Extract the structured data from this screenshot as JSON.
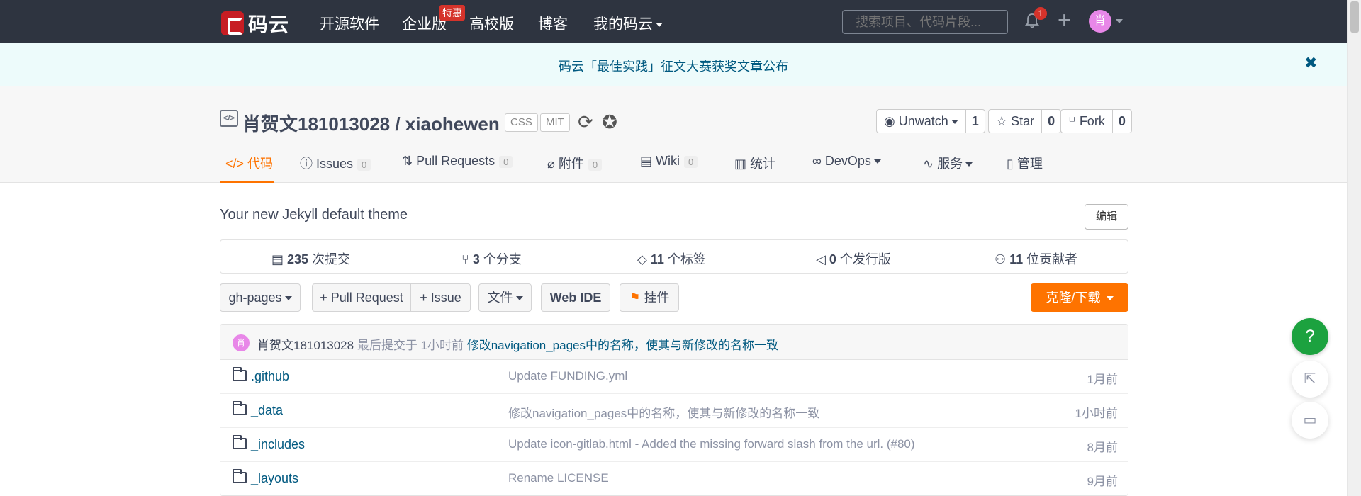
{
  "topnav": {
    "logo_text": "码云",
    "items": [
      "开源软件",
      "企业版",
      "高校版",
      "博客",
      "我的码云"
    ],
    "hot_badge": "特惠",
    "search_placeholder": "搜索项目、代码片段...",
    "notification_count": "1",
    "avatar_letter": "肖"
  },
  "notice": {
    "text": "码云「最佳实践」征文大赛获奖文章公布",
    "close": "✖"
  },
  "repo": {
    "title": "肖贺文181013028 / xiaohewen",
    "tags": [
      "CSS",
      "MIT"
    ],
    "watch_label": "Unwatch",
    "watch_count": "1",
    "star_label": "Star",
    "star_count": "0",
    "fork_label": "Fork",
    "fork_count": "0"
  },
  "tabs": [
    {
      "label": "代码",
      "icon": "code-icon"
    },
    {
      "label": "Issues",
      "count": "0"
    },
    {
      "label": "Pull Requests",
      "count": "0"
    },
    {
      "label": "附件",
      "count": "0"
    },
    {
      "label": "Wiki",
      "count": "0"
    },
    {
      "label": "统计"
    },
    {
      "label": "DevOps"
    },
    {
      "label": "服务"
    },
    {
      "label": "管理"
    }
  ],
  "description": "Your new Jekyll default theme",
  "edit_label": "编辑",
  "stats": [
    {
      "num": "235",
      "label": " 次提交"
    },
    {
      "num": "3",
      "label": " 个分支"
    },
    {
      "num": "11",
      "label": " 个标签"
    },
    {
      "num": "0",
      "label": " 个发行版"
    },
    {
      "num": "11",
      "label": " 位贡献者"
    }
  ],
  "toolbar": {
    "branch": "gh-pages",
    "pull_request": "+ Pull Request",
    "issue": "+ Issue",
    "file": "文件",
    "web_ide": "Web IDE",
    "widget": "挂件",
    "clone": "克隆/下载"
  },
  "last_commit": {
    "avatar": "肖",
    "author": "肖贺文181013028",
    "time": " 最后提交于 1小时前 ",
    "message": "修改navigation_pages中的名称，使其与新修改的名称一致"
  },
  "files": [
    {
      "name": ".github",
      "message": "Update FUNDING.yml",
      "time": "1月前"
    },
    {
      "name": "_data",
      "message": "修改navigation_pages中的名称，使其与新修改的名称一致",
      "time": "1小时前"
    },
    {
      "name": "_includes",
      "message": "Update icon-gitlab.html - Added the missing forward slash from the url. (#80)",
      "time": "8月前"
    },
    {
      "name": "_layouts",
      "message": "Rename LICENSE",
      "time": "9月前"
    }
  ],
  "float": {
    "help": "?"
  },
  "colors": {
    "accent": "#fe7300",
    "nav_bg": "#2e3440",
    "link": "#005980",
    "help": "#1ca23f"
  }
}
